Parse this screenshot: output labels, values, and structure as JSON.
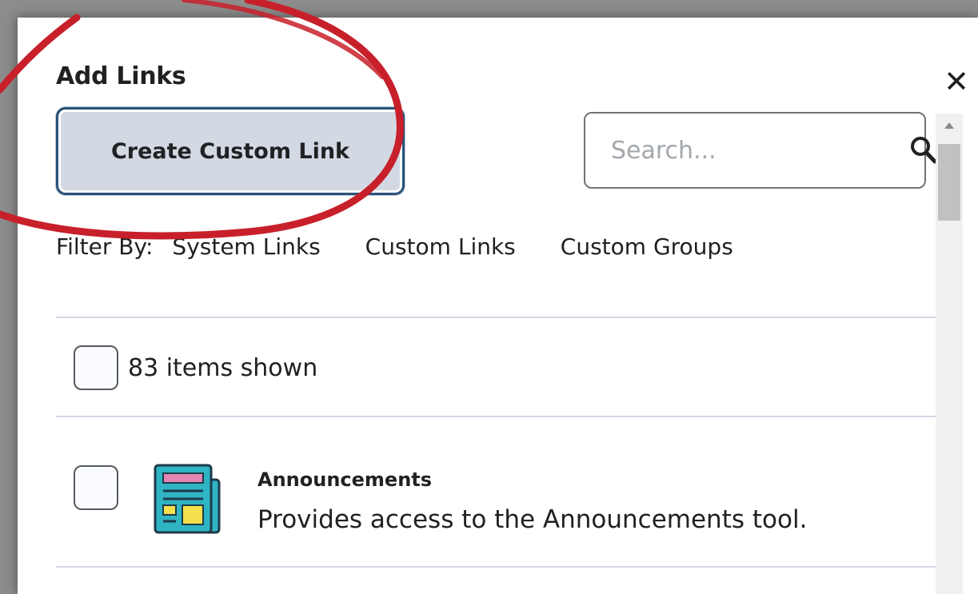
{
  "dialog": {
    "title": "Add Links",
    "close_label": "✕"
  },
  "toolbar": {
    "create_label": "Create Custom Link"
  },
  "search": {
    "placeholder": "Search...",
    "icon": "search-icon"
  },
  "filter": {
    "label": "Filter By:",
    "options": [
      "System Links",
      "Custom Links",
      "Custom Groups"
    ]
  },
  "list": {
    "count_label": "83 items shown",
    "items": [
      {
        "title": "Announcements",
        "description": "Provides access to the Announcements tool.",
        "icon": "announcements-icon"
      }
    ]
  },
  "colors": {
    "button_bg": "#d3d9e3",
    "button_border": "#29527a",
    "annotation": "#c8202a",
    "icon_teal": "#2fb4c4",
    "icon_pink": "#e386b4",
    "icon_yellow": "#f4e04d"
  }
}
